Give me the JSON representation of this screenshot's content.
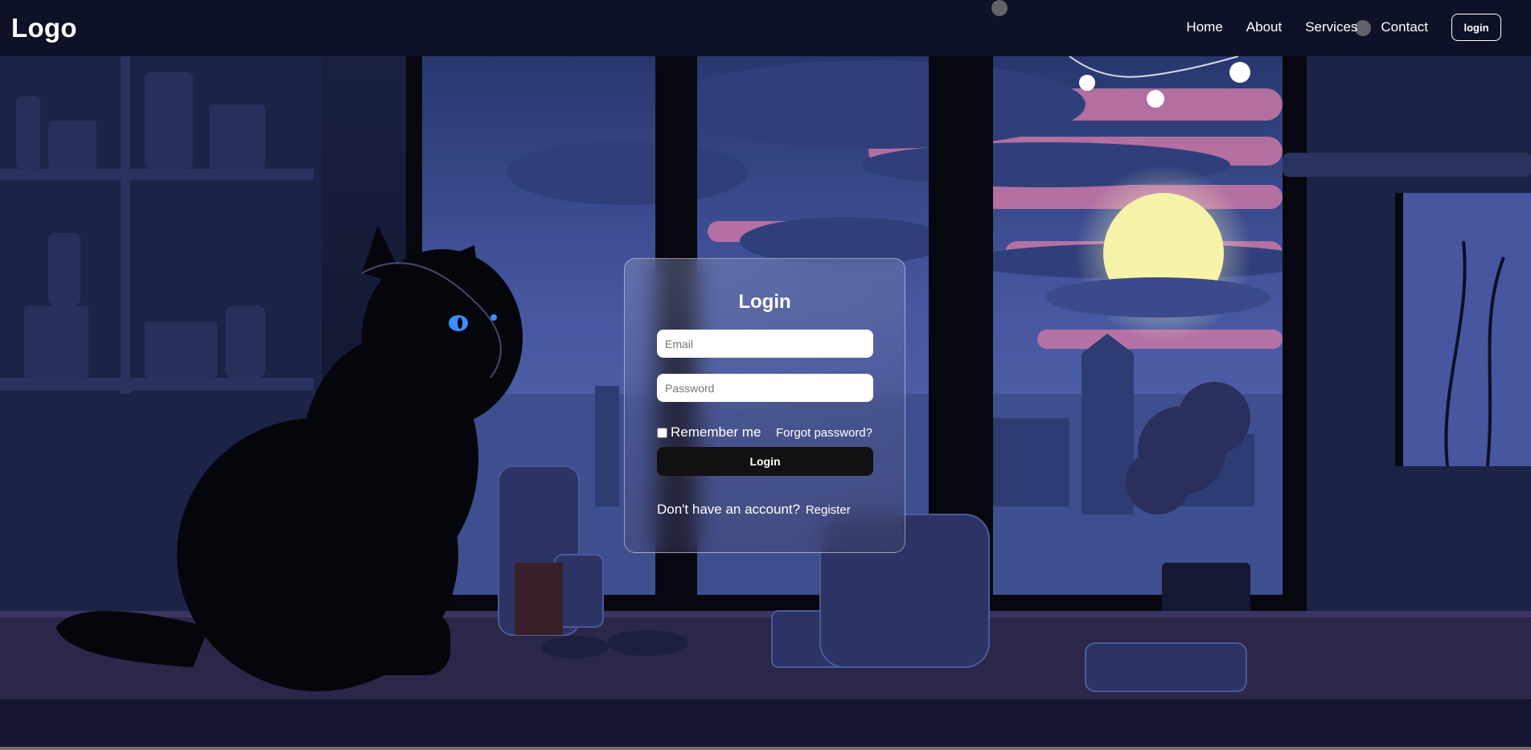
{
  "header": {
    "logo": "Logo",
    "nav_items": [
      {
        "label": "Home"
      },
      {
        "label": "About"
      },
      {
        "label": "Services"
      },
      {
        "label": "Contact"
      }
    ],
    "login_button": "login"
  },
  "login_form": {
    "title": "Login",
    "email_placeholder": "Email",
    "email_value": "",
    "password_placeholder": "Password",
    "password_value": "",
    "remember_me_label": "Remember me",
    "remember_me_checked": false,
    "forgot_password_link": "Forgot password?",
    "submit_button": "Login",
    "register_prompt": "Don't have an account?",
    "register_link": "Register"
  },
  "background": {
    "subject": "black-cat-night-window-scene",
    "colors": {
      "night_blue": "#3b4f94",
      "sunset_pink": "#d97fae",
      "moon_yellow": "#f6f2a8",
      "shadow": "#0b0d1c"
    }
  }
}
